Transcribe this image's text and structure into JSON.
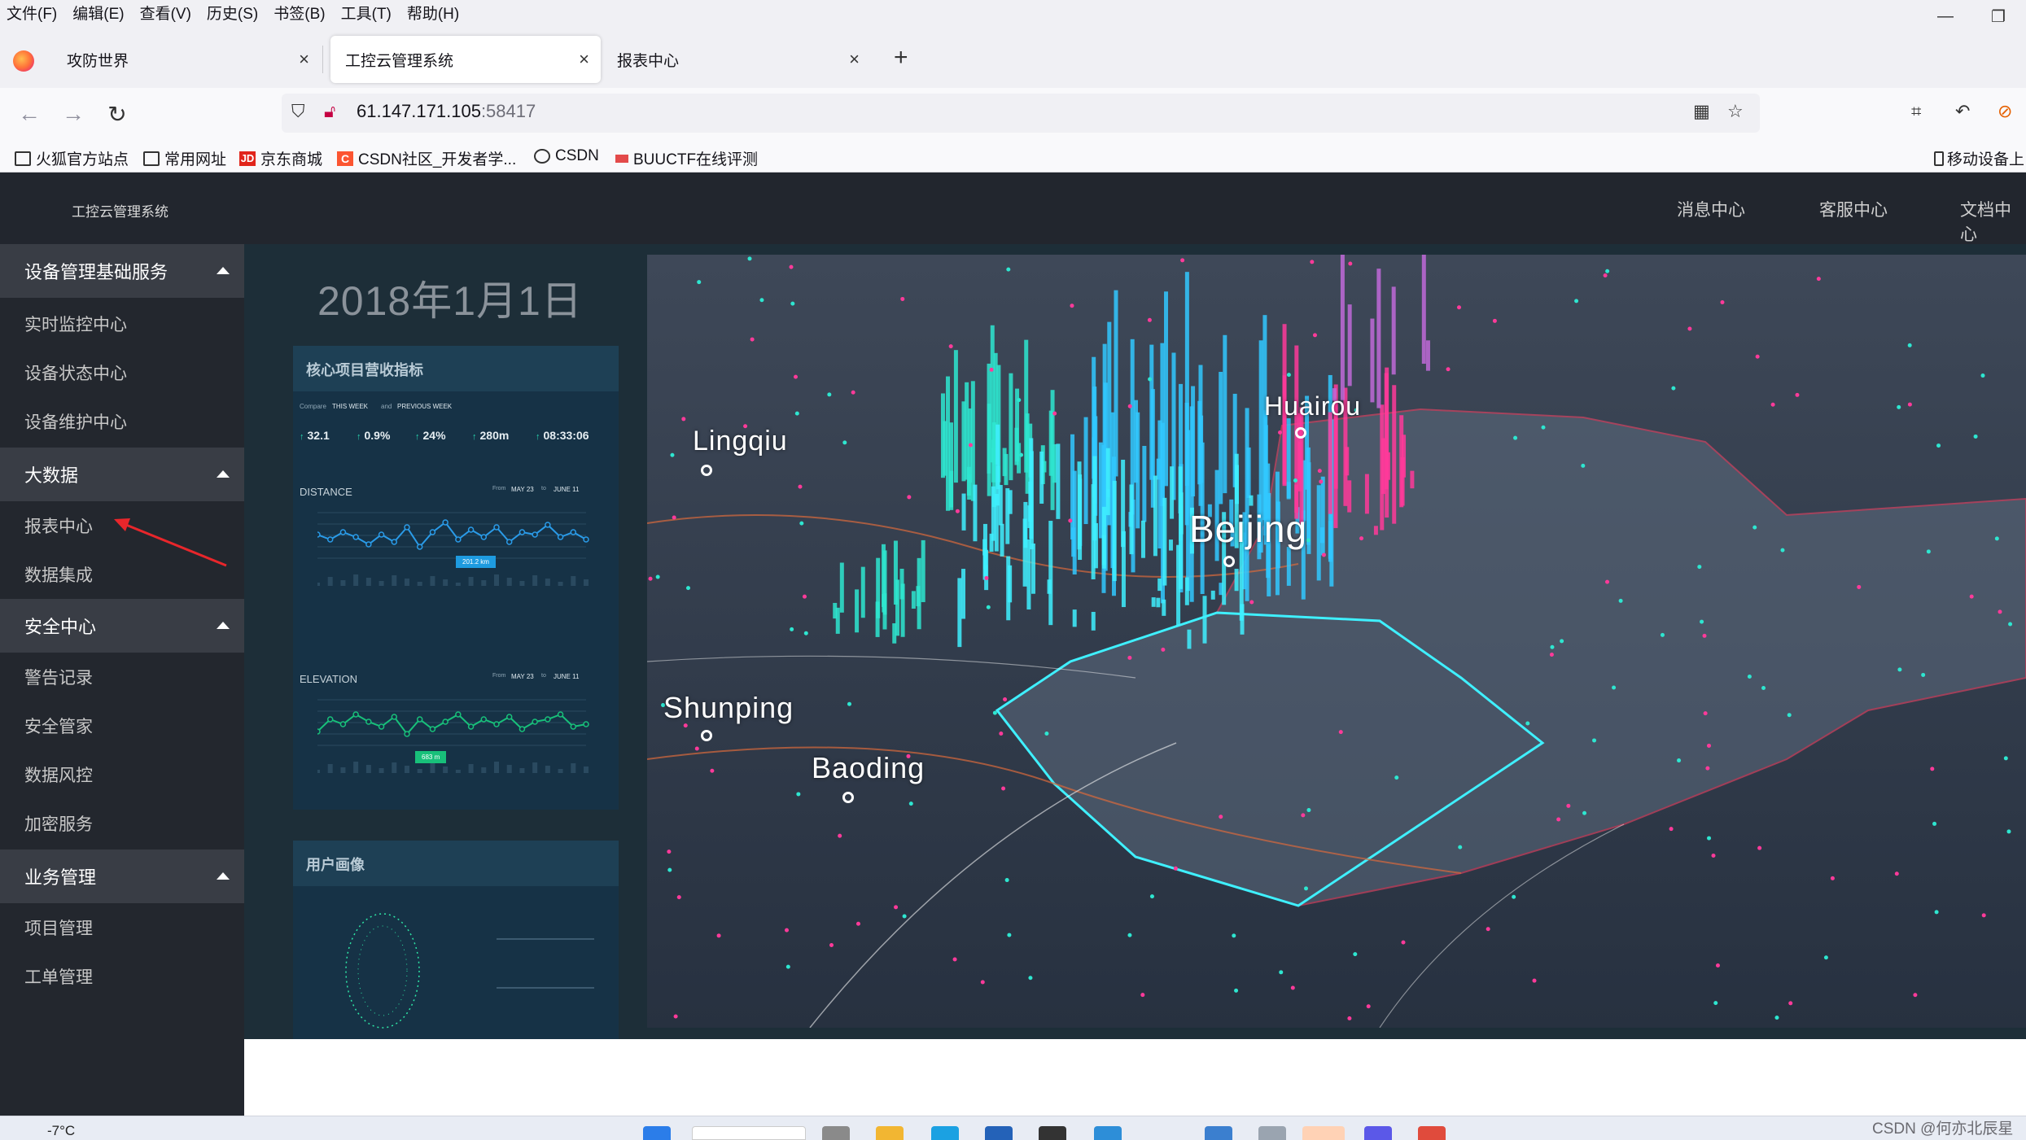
{
  "browser": {
    "menu": [
      "文件(F)",
      "编辑(E)",
      "查看(V)",
      "历史(S)",
      "书签(B)",
      "工具(T)",
      "帮助(H)"
    ],
    "tabs": [
      {
        "label": "攻防世界",
        "active": false
      },
      {
        "label": "工控云管理系统",
        "active": true
      },
      {
        "label": "报表中心",
        "active": false
      }
    ],
    "url_host": "61.147.171.105",
    "url_port": ":58417",
    "bookmarks": [
      {
        "label": "火狐官方站点",
        "icon": "folder-icon"
      },
      {
        "label": "常用网址",
        "icon": "folder-icon"
      },
      {
        "label": "京东商城",
        "icon": "jd-icon",
        "glyph": "JD"
      },
      {
        "label": "CSDN社区_开发者学...",
        "icon": "csdn-icon",
        "glyph": "C"
      },
      {
        "label": "CSDN",
        "icon": "globe-icon"
      },
      {
        "label": "BUUCTF在线评测",
        "icon": "buuctf-icon"
      }
    ],
    "mobile_bookmarks": "移动设备上"
  },
  "app": {
    "title": "工控云管理系统",
    "topnav": [
      "消息中心",
      "客服中心",
      "文档中心"
    ]
  },
  "sidebar": {
    "groups": [
      {
        "label": "设备管理基础服务",
        "items": [
          "实时监控中心",
          "设备状态中心",
          "设备维护中心"
        ]
      },
      {
        "label": "大数据",
        "items": [
          "报表中心",
          "数据集成"
        ]
      },
      {
        "label": "安全中心",
        "items": [
          "警告记录",
          "安全管家",
          "数据风控",
          "加密服务"
        ]
      },
      {
        "label": "业务管理",
        "items": [
          "项目管理",
          "工单管理"
        ]
      }
    ]
  },
  "dashboard": {
    "date": "2018年1月1日",
    "panel1": {
      "title": "核心项目营收指标",
      "compare": "Compare",
      "this_week": "THIS WEEK",
      "and": "and",
      "previous_week": "PREVIOUS WEEK",
      "stats": [
        "32.1",
        "0.9%",
        "24%",
        "280m",
        "08:33:06"
      ],
      "distance_label": "DISTANCE",
      "distance_badge": "201.2 km",
      "elevation_label": "ELEVATION",
      "elevation_badge": "683 m",
      "from": "From",
      "may23": "MAY 23",
      "to": "to",
      "june11": "JUNE 11",
      "distance_series": [
        0.55,
        0.45,
        0.6,
        0.5,
        0.35,
        0.55,
        0.4,
        0.7,
        0.3,
        0.6,
        0.8,
        0.45,
        0.65,
        0.5,
        0.7,
        0.4,
        0.6,
        0.55,
        0.75,
        0.5,
        0.6,
        0.45
      ],
      "elevation_series": [
        0.35,
        0.6,
        0.5,
        0.7,
        0.55,
        0.45,
        0.65,
        0.3,
        0.6,
        0.4,
        0.55,
        0.7,
        0.45,
        0.6,
        0.5,
        0.65,
        0.4,
        0.55,
        0.6,
        0.7,
        0.45,
        0.5
      ]
    },
    "panel2": {
      "title": "用户画像"
    },
    "map": {
      "cities": [
        "Lingqiu",
        "Huairou",
        "Beijing",
        "Shunping",
        "Baoding"
      ]
    }
  },
  "taskbar": {
    "weather": "-7°C",
    "watermark": "CSDN @何亦北辰星"
  }
}
